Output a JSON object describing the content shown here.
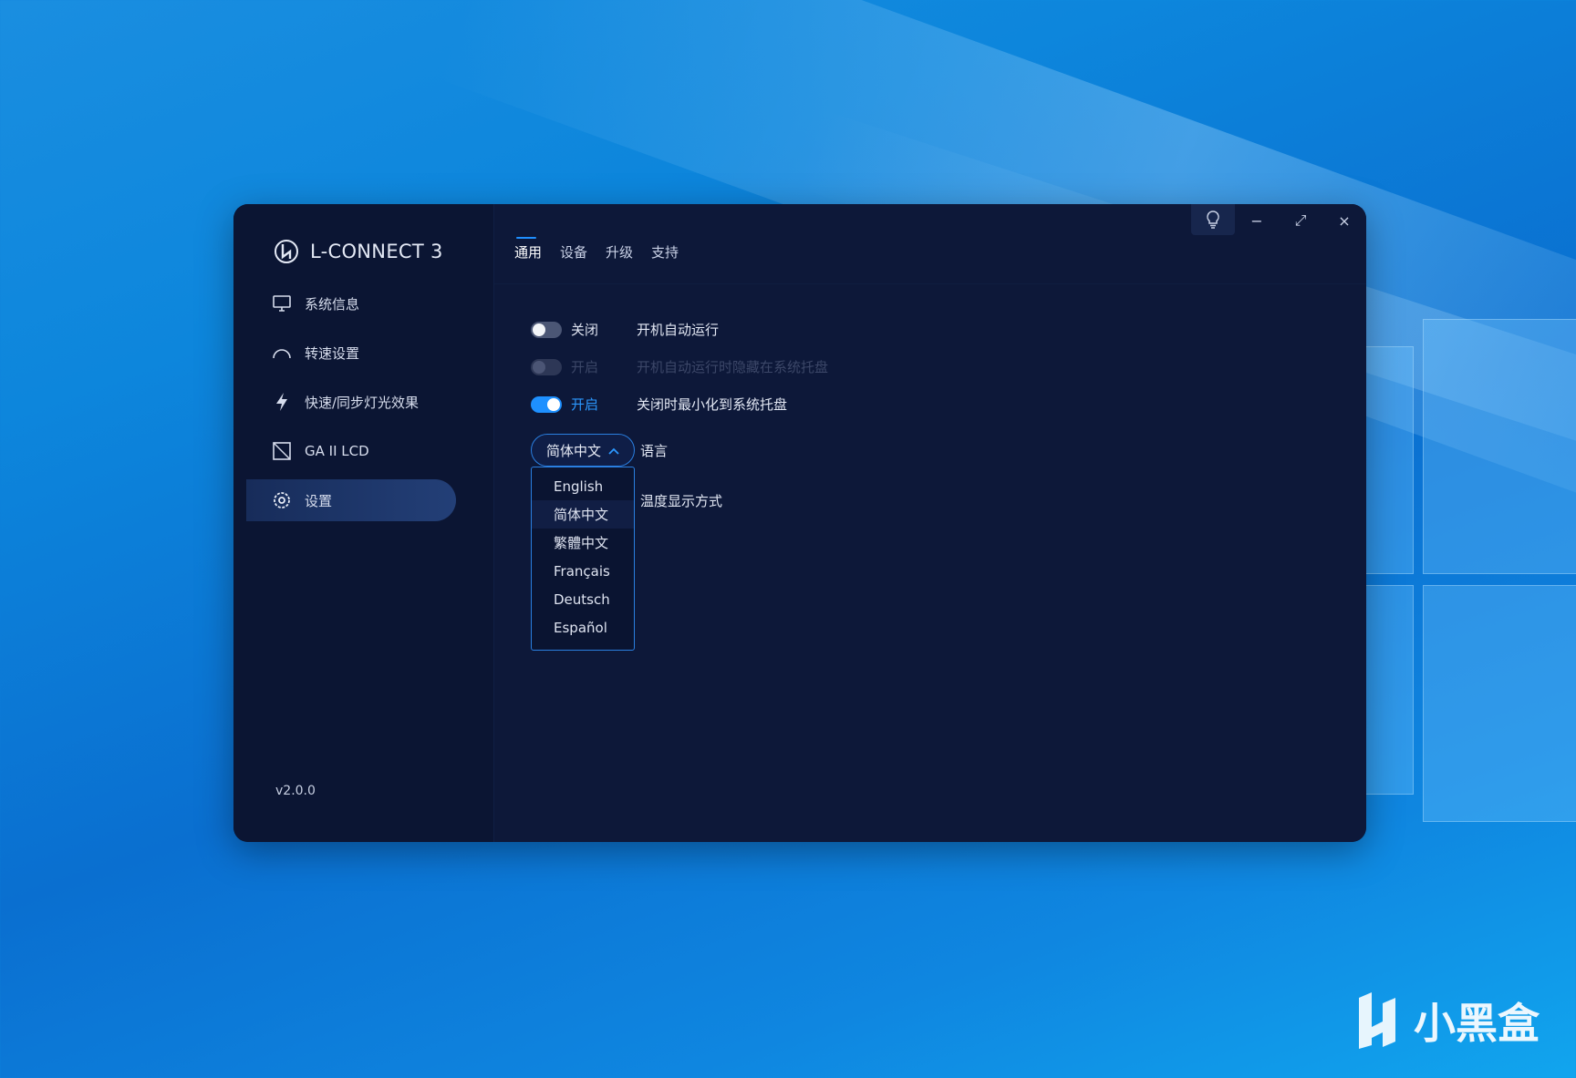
{
  "app": {
    "name": "L-CONNECT 3",
    "version": "v2.0.0"
  },
  "sidebar": {
    "items": [
      {
        "label": "系统信息",
        "icon": "monitor-icon"
      },
      {
        "label": "转速设置",
        "icon": "speedometer-icon"
      },
      {
        "label": "快速/同步灯光效果",
        "icon": "lightning-icon"
      },
      {
        "label": "GA II LCD",
        "icon": "lcd-screen-icon"
      },
      {
        "label": "设置",
        "icon": "gear-icon",
        "active": true
      }
    ]
  },
  "tabs": [
    {
      "label": "通用",
      "active": true
    },
    {
      "label": "设备"
    },
    {
      "label": "升级"
    },
    {
      "label": "支持"
    }
  ],
  "window_controls": {
    "bulb": "lightbulb-icon",
    "minimize": "−",
    "maximize": "⤢",
    "close": "×"
  },
  "settings": {
    "autostart": {
      "state": "关闭",
      "label": "开机自动运行",
      "on": false
    },
    "hide_tray": {
      "state": "开启",
      "label": "开机自动运行时隐藏在系统托盘",
      "on": false,
      "disabled": true
    },
    "minimize_tray": {
      "state": "开启",
      "label": "关闭时最小化到系统托盘",
      "on": true
    },
    "language": {
      "label": "语言",
      "selected": "简体中文",
      "options": [
        "English",
        "简体中文",
        "繁體中文",
        "Français",
        "Deutsch",
        "Español"
      ]
    },
    "temperature": {
      "label": "温度显示方式"
    }
  },
  "watermark": {
    "text": "小黑盒"
  },
  "colors": {
    "accent": "#1e90ff",
    "window_bg": "#0d1839",
    "sidebar_bg": "#0b1533"
  }
}
